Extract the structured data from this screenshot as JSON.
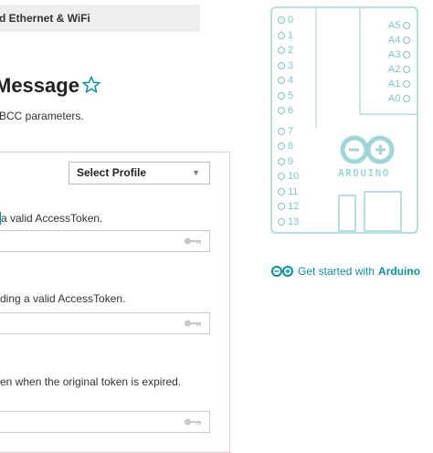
{
  "breadcrumb": {
    "label": "d Ethernet & WiFi"
  },
  "page": {
    "title": "Message",
    "subtitle": "BCC parameters."
  },
  "form": {
    "profile_select": {
      "selected": "Select Profile",
      "arrow": "▼"
    },
    "fields": [
      {
        "label_link": "",
        "label_text": " a valid AccessToken.",
        "value": ""
      },
      {
        "label_link": "",
        "label_text": "ding a valid AccessToken.",
        "value": ""
      },
      {
        "label_link": "",
        "label_text": "en when the original token is expired.",
        "value": ""
      }
    ]
  },
  "board": {
    "left_pins": [
      "0",
      "1",
      "2",
      "3",
      "4",
      "5",
      "6",
      "7",
      "8",
      "9",
      "10",
      "11",
      "12",
      "13"
    ],
    "right_pins": [
      "A5",
      "A4",
      "A3",
      "A2",
      "A1",
      "A0"
    ],
    "logo_text": "ARDUINO",
    "accent_color": "#7fc5c8"
  },
  "get_started": {
    "text": "Get started with",
    "brand": "Arduino"
  },
  "colors": {
    "accent": "#00979c",
    "panel_border": "#f2c6cc",
    "breadcrumb_bg": "#eeeeee"
  }
}
